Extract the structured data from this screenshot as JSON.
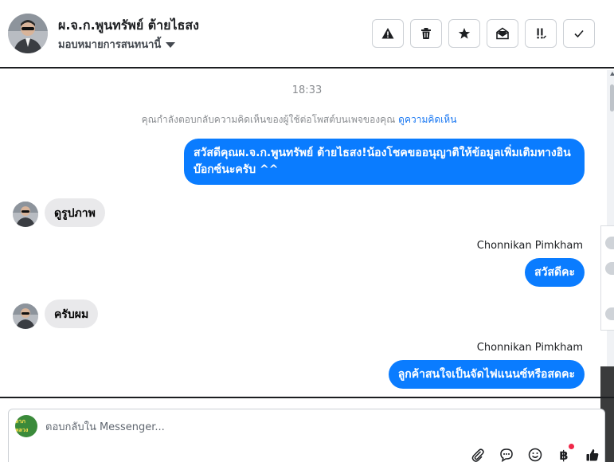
{
  "header": {
    "name": "ผ.จ.ก.พูนทรัพย์ ต้ายไธสง",
    "assign_label": "มอบหมายการสนทนานี้",
    "actions": [
      "report",
      "delete",
      "star",
      "mark-unread",
      "important",
      "done"
    ]
  },
  "conversation": {
    "timestamp": "18:33",
    "system_note": "คุณกำลังตอบกลับความคิดเห็นของผู้ใช้ต่อโพสต์บนเพจของคุณ",
    "system_link": "ดูความคิดเห็น",
    "messages": [
      {
        "direction": "out",
        "text": "สวัสดีคุณผ.จ.ก.พูนทรัพย์ ต้ายไธสง!น้องโชคขออนุญาติให้ข้อมูลเพิ่มเติมทางอินบ๊อกซ์นะครับ ^^"
      },
      {
        "direction": "in",
        "text": "ดูรูปภาพ"
      },
      {
        "direction": "out",
        "sender": "Chonnikan Pimkham",
        "text": "สวัสดีคะ"
      },
      {
        "direction": "in",
        "text": "ครับผม"
      },
      {
        "direction": "out",
        "sender": "Chonnikan Pimkham",
        "text": "ลูกค้าสนใจเป็นจัดไฟแนนซ์หรือสดคะ"
      }
    ]
  },
  "composer": {
    "page_logo_text": "ลาภหลวง",
    "placeholder": "ตอบกลับใน Messenger...",
    "tools": [
      "paperclip-icon",
      "chat-bubble-icon",
      "emoji-icon",
      "baht-icon",
      "thumbs-up-icon"
    ],
    "baht_symbol": "฿"
  },
  "colors": {
    "outgoing_bubble": "#0a7cff",
    "incoming_bubble": "#e9e9eb",
    "link": "#1877f2"
  }
}
